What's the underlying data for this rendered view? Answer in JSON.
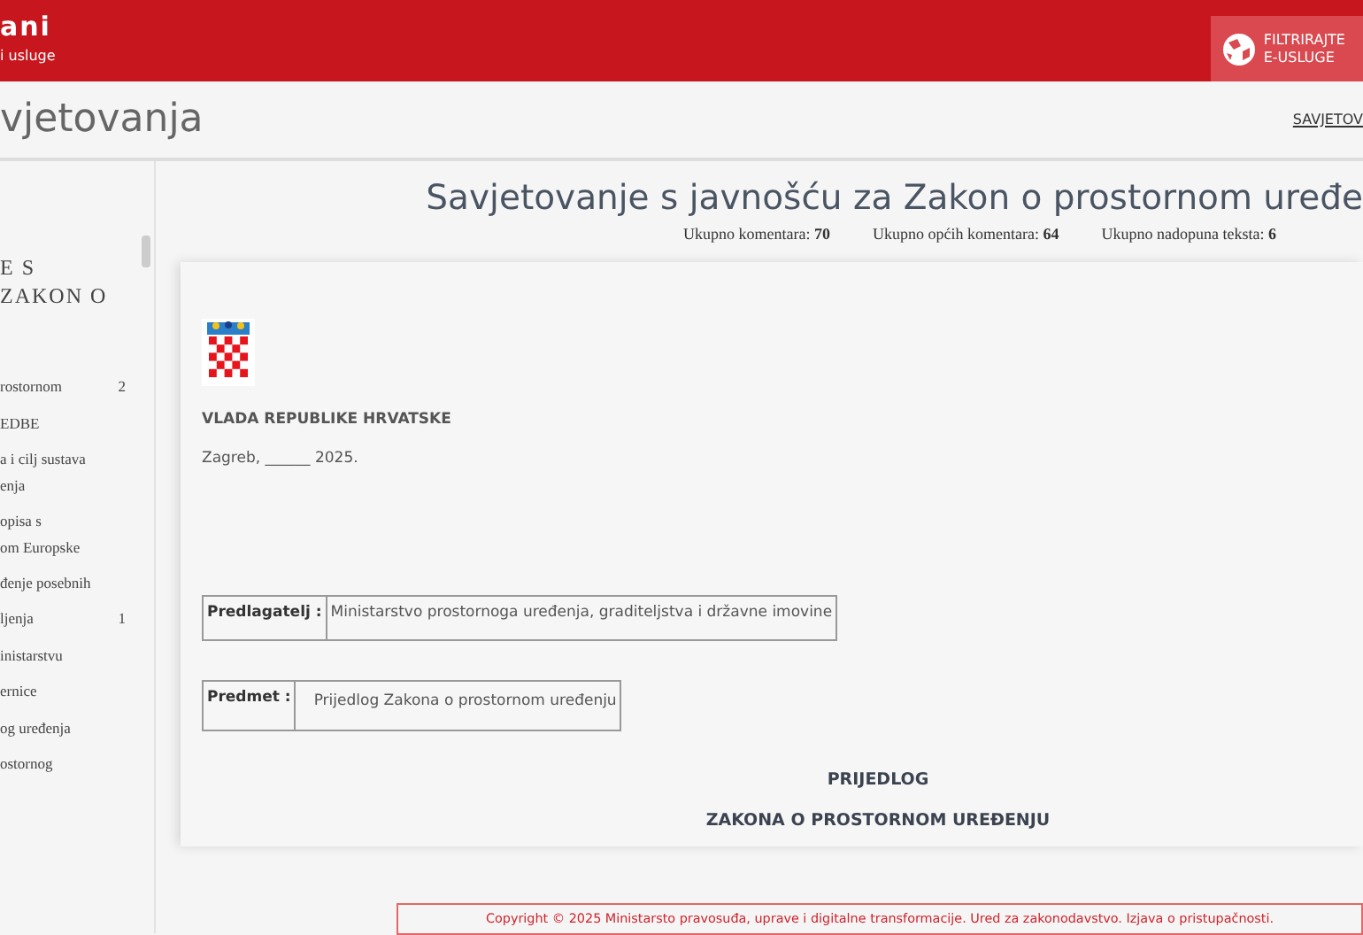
{
  "header": {
    "brand": "ani",
    "brand_subtitle": "i usluge",
    "filter_button": [
      "FILTRIRAJTE",
      "E-USLUGE"
    ]
  },
  "subheader": {
    "title": "vjetovanja",
    "nav_link": "SAVJETOV"
  },
  "sidebar": {
    "title": [
      "E S",
      "ZAKON O"
    ],
    "items": [
      {
        "lines": [
          "rostornom"
        ],
        "count": "2"
      },
      {
        "lines": [
          "EDBE"
        ]
      },
      {
        "lines": [
          "a i cilj sustava",
          "enja"
        ]
      },
      {
        "lines": [
          "opisa s",
          "om Europske"
        ]
      },
      {
        "lines": [
          "đenje posebnih"
        ]
      },
      {
        "lines": [
          "ljenja"
        ],
        "count": "1"
      },
      {
        "lines": [
          "inistarstvu"
        ]
      },
      {
        "lines": [
          "ernice"
        ]
      },
      {
        "lines": [
          "og uređenja"
        ]
      },
      {
        "lines": [
          "ostornog"
        ]
      }
    ]
  },
  "page_title": "Savjetovanje s javnošću za Zakon o prostornom uređe",
  "stats": [
    {
      "label": "Ukupno komentara:",
      "value": "70"
    },
    {
      "label": "Ukupno općih komentara:",
      "value": "64"
    },
    {
      "label": "Ukupno nadopuna teksta:",
      "value": "6"
    }
  ],
  "document": {
    "issuer": "VLADA REPUBLIKE HRVATSKE",
    "place_date": "Zagreb, ______ 2025.",
    "fields": [
      {
        "label": "Predlagatelj :",
        "value": "Ministarstvo prostornoga uređenja, graditeljstva i državne imovine"
      },
      {
        "label": "Predmet :",
        "value": "Prijedlog Zakona o prostornom uređenju"
      }
    ],
    "headings": [
      "PRIJEDLOG",
      "ZAKONA O PROSTORNOM UREĐENJU"
    ]
  },
  "footer": "Copyright © 2025 Ministarsto pravosuđa, uprave i digitalne transformacije. Ured za zakonodavstvo. Izjava o pristupačnosti."
}
